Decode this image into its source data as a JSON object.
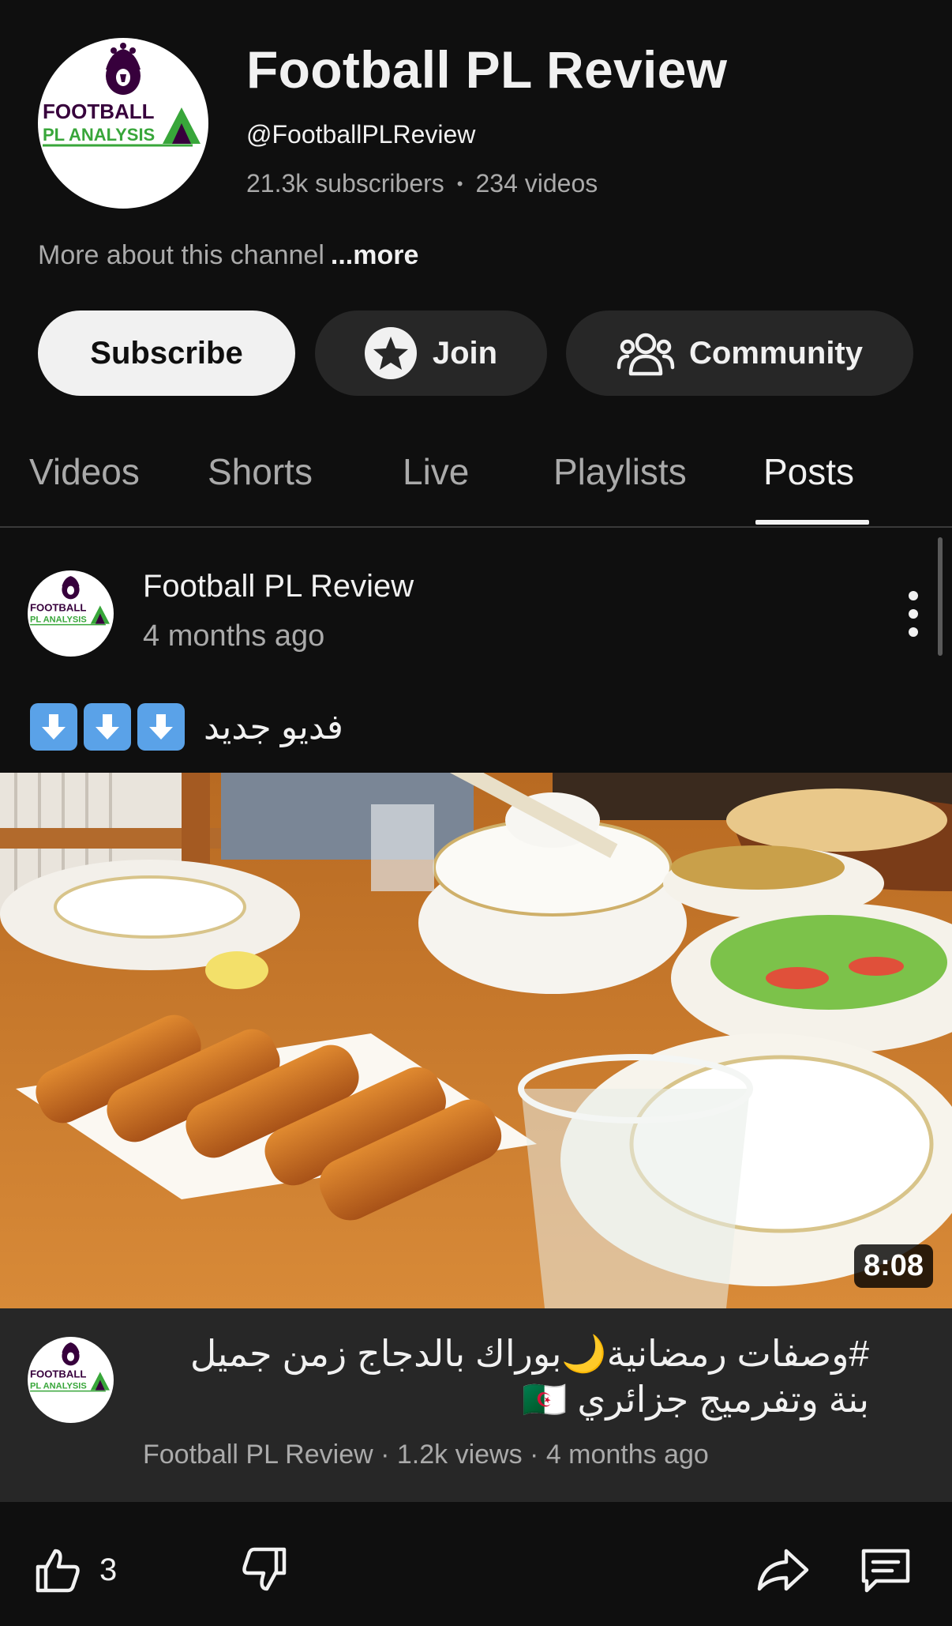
{
  "channel": {
    "title": "Football PL Review",
    "handle": "@FootballPLReview",
    "subscribers": "21.3k subscribers",
    "stats_separator": "•",
    "videos": "234 videos",
    "about": "More about this channel",
    "more_link": "...more",
    "logo_text_line1": "FOOTBALL",
    "logo_text_line2": "PL ANALYSIS"
  },
  "buttons": {
    "subscribe": "Subscribe",
    "join": "Join",
    "community": "Community"
  },
  "tabs": [
    {
      "label": "Videos",
      "active": false
    },
    {
      "label": "Shorts",
      "active": false
    },
    {
      "label": "Live",
      "active": false
    },
    {
      "label": "Playlists",
      "active": false
    },
    {
      "label": "Posts",
      "active": true
    }
  ],
  "post": {
    "author": "Football PL Review",
    "time": "4 months ago",
    "text": "فديو جديد",
    "arrow_emoji_count": 3,
    "video": {
      "duration": "8:08",
      "title": "#وصفات رمضانية🌙بوراك بالدجاج زمن جميل بنة وتفرميج جزائري 🇩🇿",
      "meta": "Football PL Review · 1.2k views · 4 months ago"
    },
    "likes": "3"
  },
  "icons": {
    "join": "star-icon",
    "community": "people-icon",
    "menu": "more-vert-icon",
    "like": "thumbs-up-icon",
    "dislike": "thumbs-down-icon",
    "share": "share-icon",
    "comment": "comment-icon",
    "arrow_emoji": "down-arrow-emoji"
  },
  "colors": {
    "background": "#0f0f0f",
    "surface": "#272727",
    "text_primary": "#f1f1f1",
    "text_secondary": "#aaaaaa",
    "logo_purple": "#37003c",
    "logo_green": "#38a63a"
  }
}
